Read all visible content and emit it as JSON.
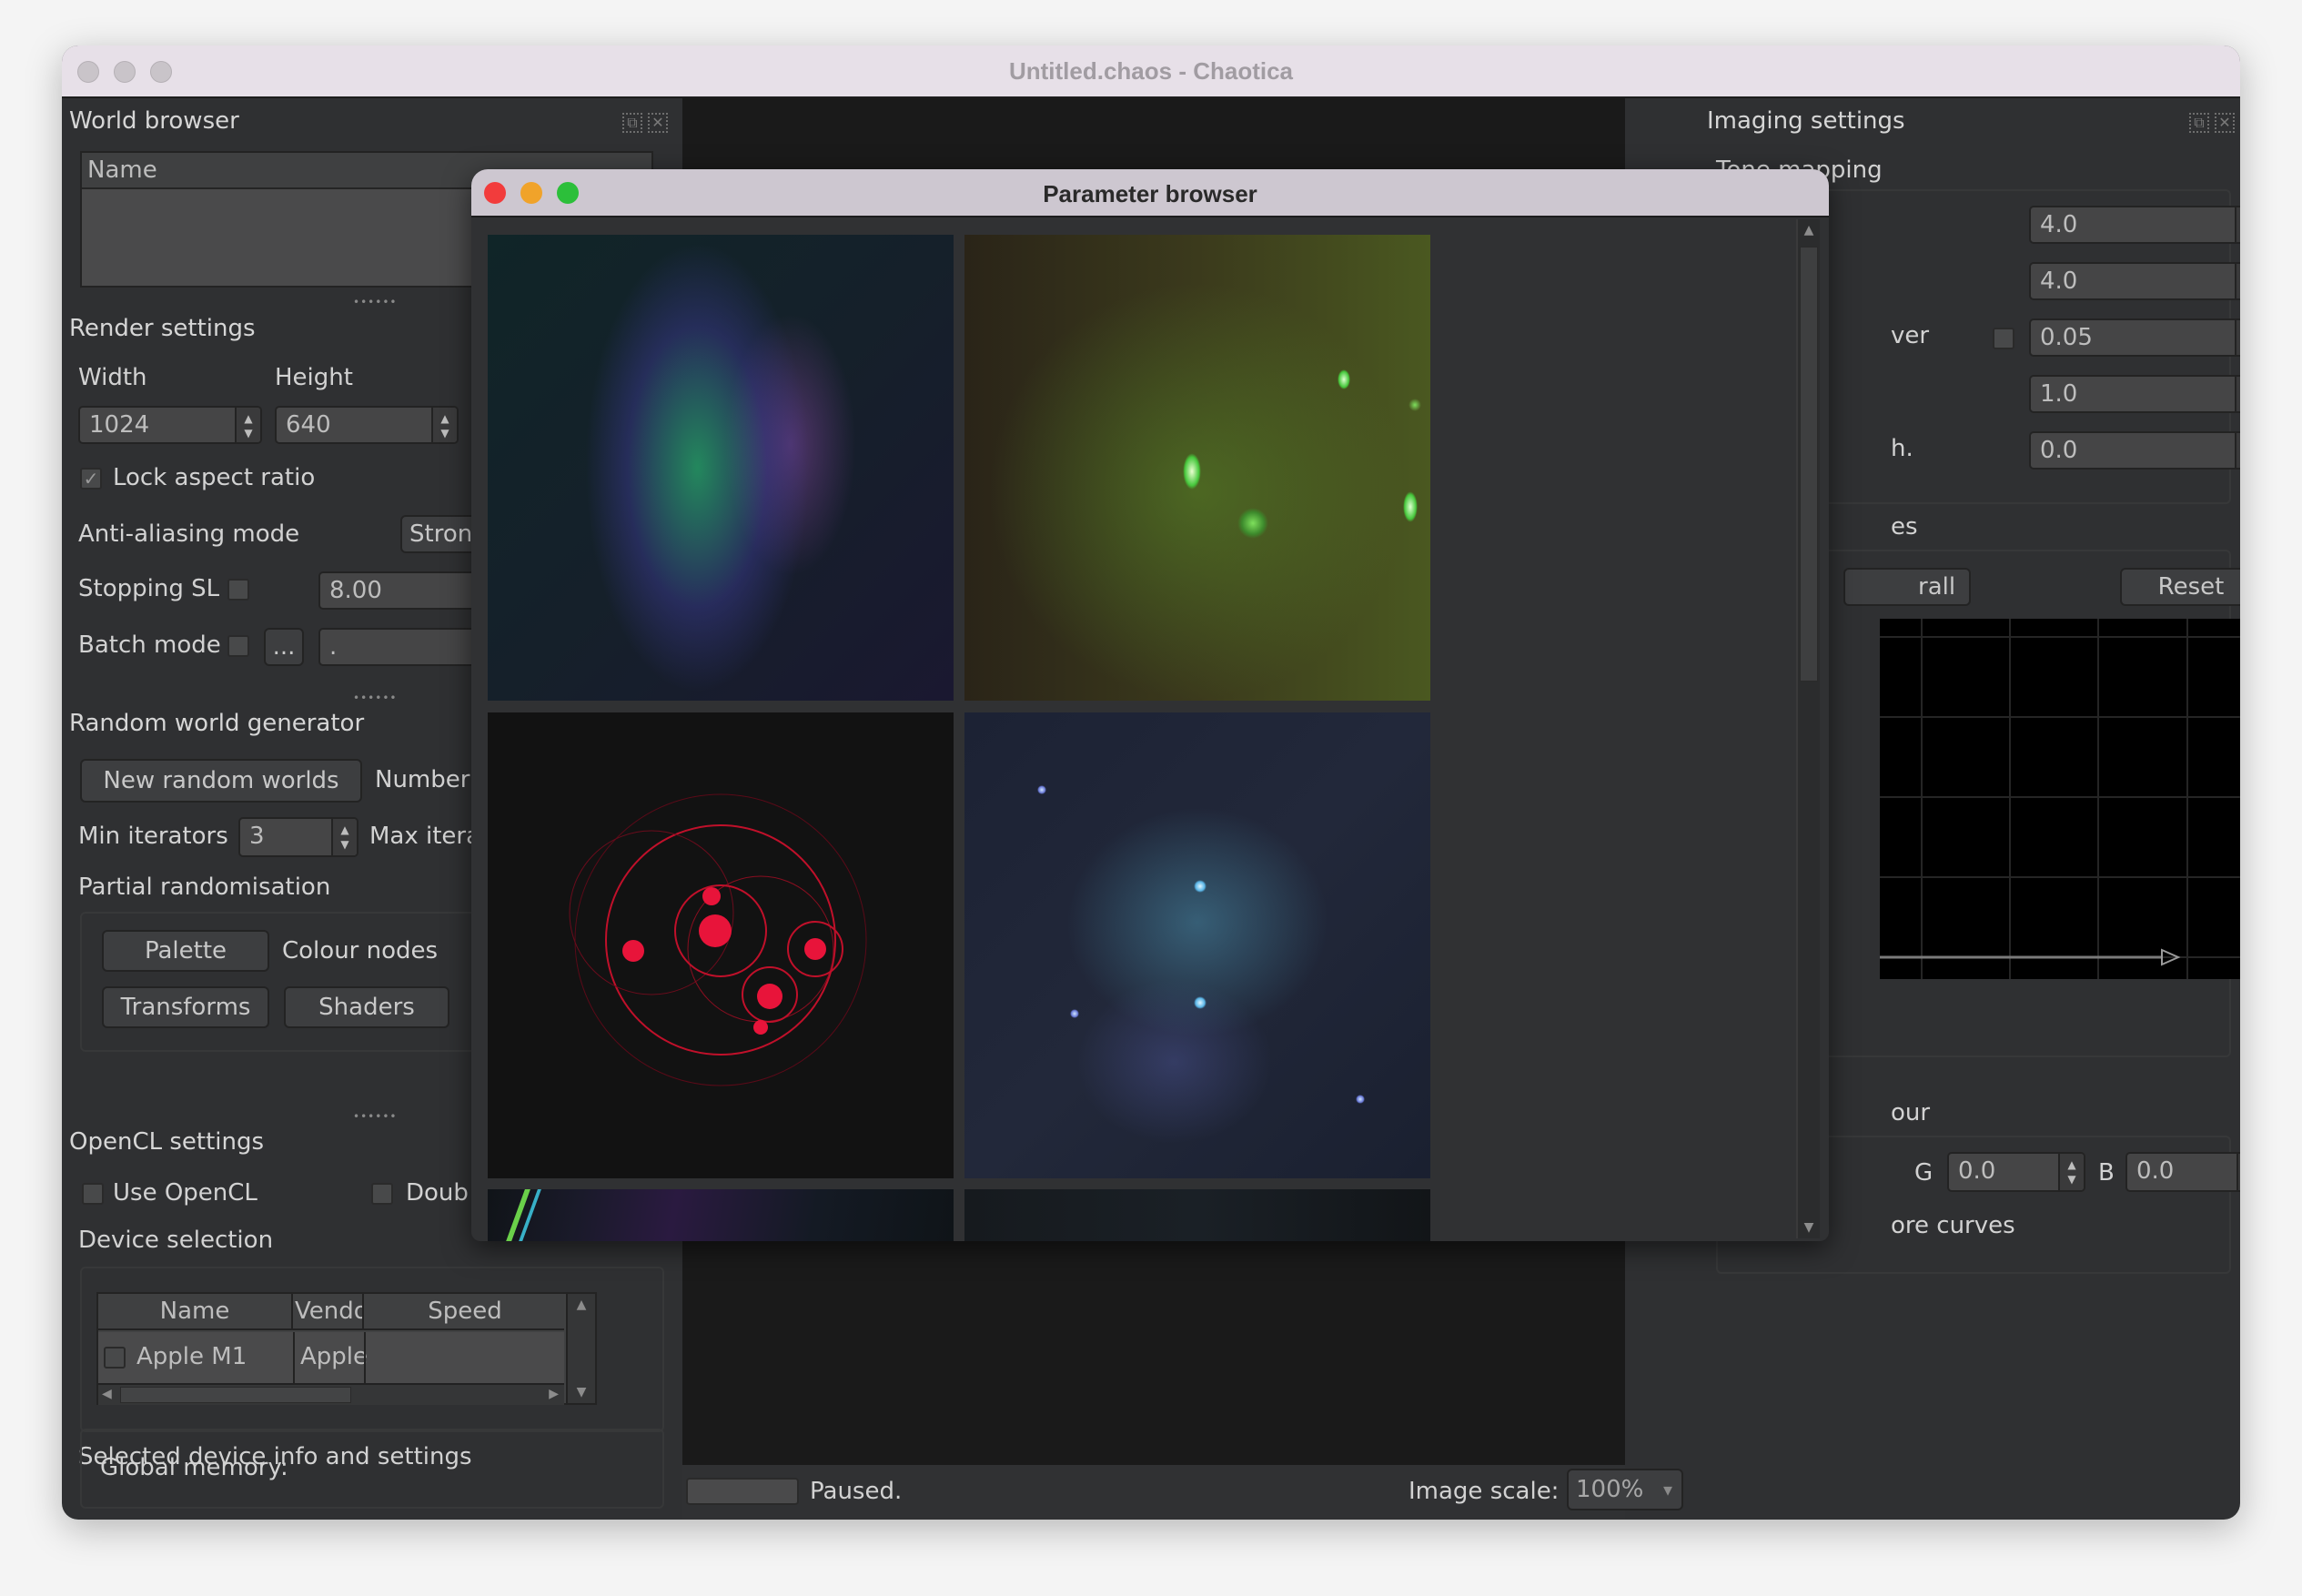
{
  "window": {
    "title": "Untitled.chaos - Chaotica"
  },
  "world_browser": {
    "title": "World browser",
    "column_name": "Name"
  },
  "render_settings": {
    "title": "Render settings",
    "width_label": "Width",
    "height_label": "Height",
    "width_value": "1024",
    "height_value": "640",
    "lock_aspect_label": "Lock aspect ratio",
    "lock_aspect_checked": true,
    "antialias_label": "Anti-aliasing mode",
    "antialias_value": "Stron",
    "stopping_sl_label": "Stopping SL",
    "stopping_sl_value": "8.00",
    "batch_mode_label": "Batch mode",
    "batch_browse_label": "...",
    "batch_path_value": "."
  },
  "random_world": {
    "title": "Random world generator",
    "new_button": "New random worlds",
    "number_label": "Number",
    "min_iter_label": "Min iterators",
    "min_iter_value": "3",
    "max_iter_label": "Max itera",
    "partial_title": "Partial randomisation",
    "palette_button": "Palette",
    "colour_nodes_label": "Colour nodes",
    "transforms_button": "Transforms",
    "shaders_button": "Shaders"
  },
  "opencl": {
    "title": "OpenCL settings",
    "use_opencl_label": "Use OpenCL",
    "double_label": "Doub",
    "device_selection_title": "Device selection",
    "columns": [
      "Name",
      "Vendor",
      "Speed"
    ],
    "rows": [
      {
        "name": "Apple M1",
        "vendor": "Apple",
        "speed": ""
      }
    ],
    "device_info_title": "Selected device info and settings",
    "global_memory_label": "Global memory:"
  },
  "status_bar": {
    "status_text": "Paused.",
    "image_scale_label": "Image scale:",
    "image_scale_value": "100%"
  },
  "imaging_settings": {
    "title": "Imaging settings",
    "tone_mapping_title": "Tone mapping",
    "tone_fields": [
      {
        "label": "",
        "value": "4.0"
      },
      {
        "label": "",
        "value": "4.0"
      },
      {
        "label": "ver",
        "value": "0.05"
      },
      {
        "label": "",
        "value": "1.0"
      },
      {
        "label": "h.",
        "value": "0.0"
      }
    ],
    "curves_title_partial": "es",
    "curve_channel_value": "rall",
    "reset_button": "Reset",
    "colour_title_partial": "our",
    "g_label": "G",
    "g_value": "0.0",
    "b_label": "B",
    "b_value": "0.0",
    "ignore_curves_partial": "ore curves"
  },
  "parameter_browser": {
    "title": "Parameter browser",
    "thumbnails": [
      {
        "name": "thumb-1",
        "palette": "green-violet-nebula"
      },
      {
        "name": "thumb-2",
        "palette": "olive-green-orbs"
      },
      {
        "name": "thumb-3",
        "palette": "red-circles"
      },
      {
        "name": "thumb-4",
        "palette": "blue-cyan-web"
      },
      {
        "name": "thumb-5",
        "palette": "multicolor-streaks"
      },
      {
        "name": "thumb-6",
        "palette": "dark-teal"
      }
    ]
  },
  "icons": {
    "float": "⧉",
    "close": "✕",
    "spin_up": "▲",
    "spin_down": "▼",
    "dropdown": "▾",
    "check": "✓",
    "scroll_left": "◀",
    "scroll_right": "▶"
  }
}
